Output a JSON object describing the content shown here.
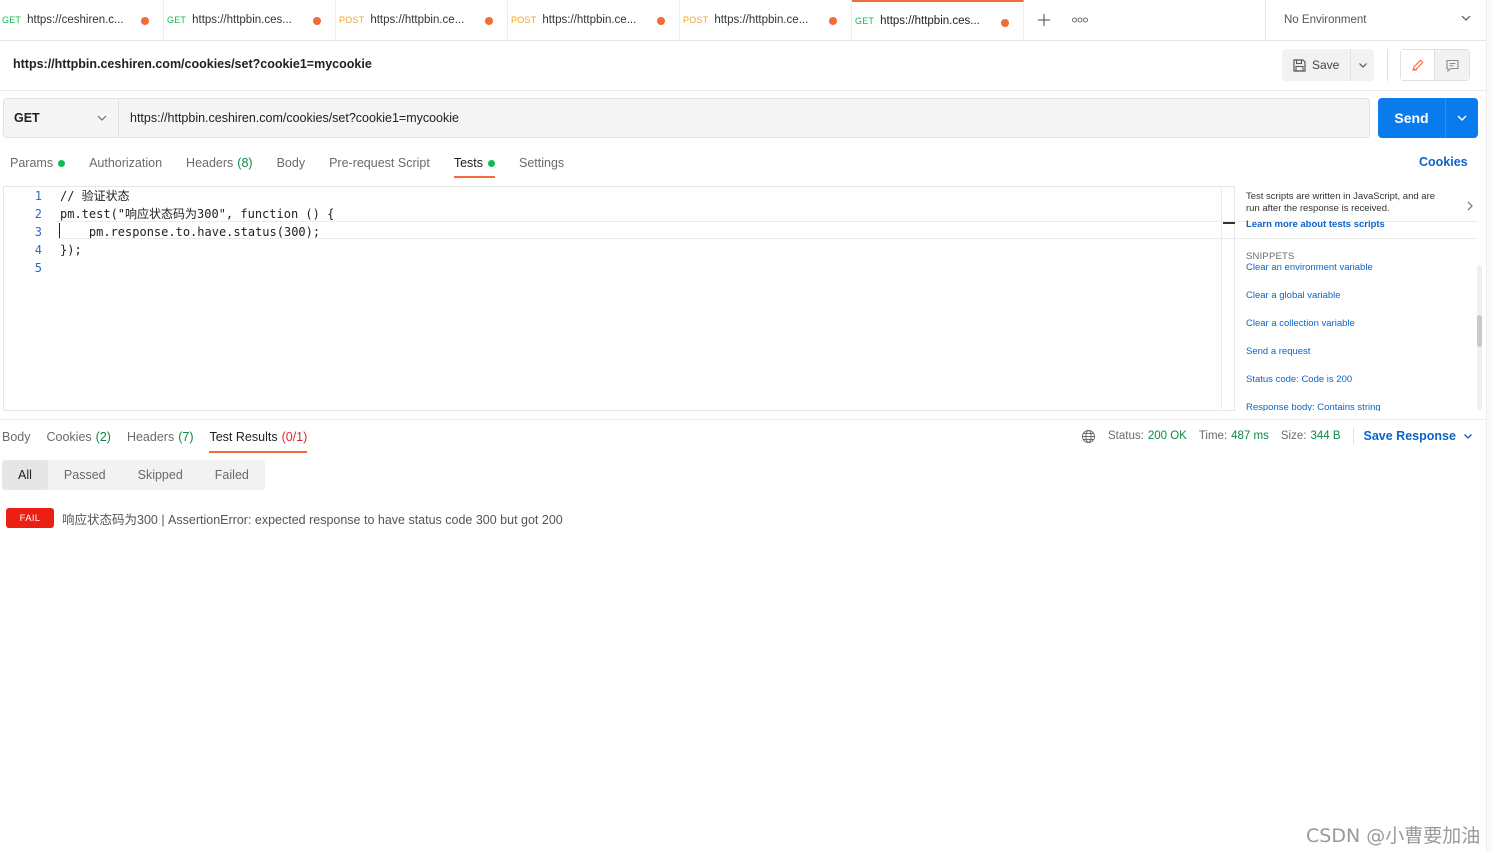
{
  "tabs": [
    {
      "method": "GET",
      "url": "https://ceshiren.c...",
      "active": false
    },
    {
      "method": "GET",
      "url": "https://httpbin.ces...",
      "active": false
    },
    {
      "method": "POST",
      "url": "https://httpbin.ce...",
      "active": false
    },
    {
      "method": "POST",
      "url": "https://httpbin.ce...",
      "active": false
    },
    {
      "method": "POST",
      "url": "https://httpbin.ce...",
      "active": false
    },
    {
      "method": "GET",
      "url": "https://httpbin.ces...",
      "active": true
    }
  ],
  "tab_icons": {
    "add": "plus-icon",
    "more": "ellipsis-icon"
  },
  "environment": {
    "label": "No Environment",
    "icon": "chevron-down-icon"
  },
  "request": {
    "title": "https://httpbin.ceshiren.com/cookies/set?cookie1=mycookie",
    "method": "GET",
    "url": "https://httpbin.ceshiren.com/cookies/set?cookie1=mycookie",
    "save_label": "Save",
    "send_label": "Send",
    "cookies_link": "Cookies"
  },
  "request_tabs": [
    {
      "label": "Params",
      "count": "",
      "dot": true,
      "active": false
    },
    {
      "label": "Authorization",
      "count": "",
      "dot": false,
      "active": false
    },
    {
      "label": "Headers",
      "count": "(8)",
      "dot": false,
      "active": false
    },
    {
      "label": "Body",
      "count": "",
      "dot": false,
      "active": false
    },
    {
      "label": "Pre-request Script",
      "count": "",
      "dot": false,
      "active": false
    },
    {
      "label": "Tests",
      "count": "",
      "dot": true,
      "active": true
    },
    {
      "label": "Settings",
      "count": "",
      "dot": false,
      "active": false
    }
  ],
  "editor": {
    "lines": [
      {
        "no": "1",
        "text": "// 验证状态"
      },
      {
        "no": "2",
        "text": "pm.test(\"响应状态码为300\", function () {"
      },
      {
        "no": "3",
        "text": "    pm.response.to.have.status(300);"
      },
      {
        "no": "4",
        "text": "});"
      },
      {
        "no": "5",
        "text": ""
      }
    ]
  },
  "help_panel": {
    "description": "Test scripts are written in JavaScript, and are run after the response is received.",
    "learn_more": "Learn more about tests scripts",
    "snippets_heading": "SNIPPETS",
    "snippets": [
      "Clear an environment variable",
      "Clear a global variable",
      "Clear a collection variable",
      "Send a request",
      "Status code: Code is 200",
      "Response body: Contains string"
    ]
  },
  "response_tabs": [
    {
      "label": "Body",
      "count": "",
      "active": false
    },
    {
      "label": "Cookies",
      "count": "(2)",
      "active": false
    },
    {
      "label": "Headers",
      "count": "(7)",
      "active": false
    },
    {
      "label": "Test Results",
      "count": "(0/1)",
      "active": true
    }
  ],
  "response_meta": {
    "status_label": "Status:",
    "status_value": "200 OK",
    "time_label": "Time:",
    "time_value": "487 ms",
    "size_label": "Size:",
    "size_value": "344 B",
    "save_response": "Save Response"
  },
  "filters": [
    "All",
    "Passed",
    "Skipped",
    "Failed"
  ],
  "active_filter": "All",
  "results": [
    {
      "status": "FAIL",
      "text": "响应状态码为300 | AssertionError: expected response to have status code 300 but got 200"
    }
  ],
  "watermark": "CSDN @小曹要加油",
  "colors": {
    "accent": "#f26b3a",
    "send": "#097bed",
    "link": "#0b64c9",
    "success": "#0cbb52",
    "fail": "#eb2013"
  }
}
